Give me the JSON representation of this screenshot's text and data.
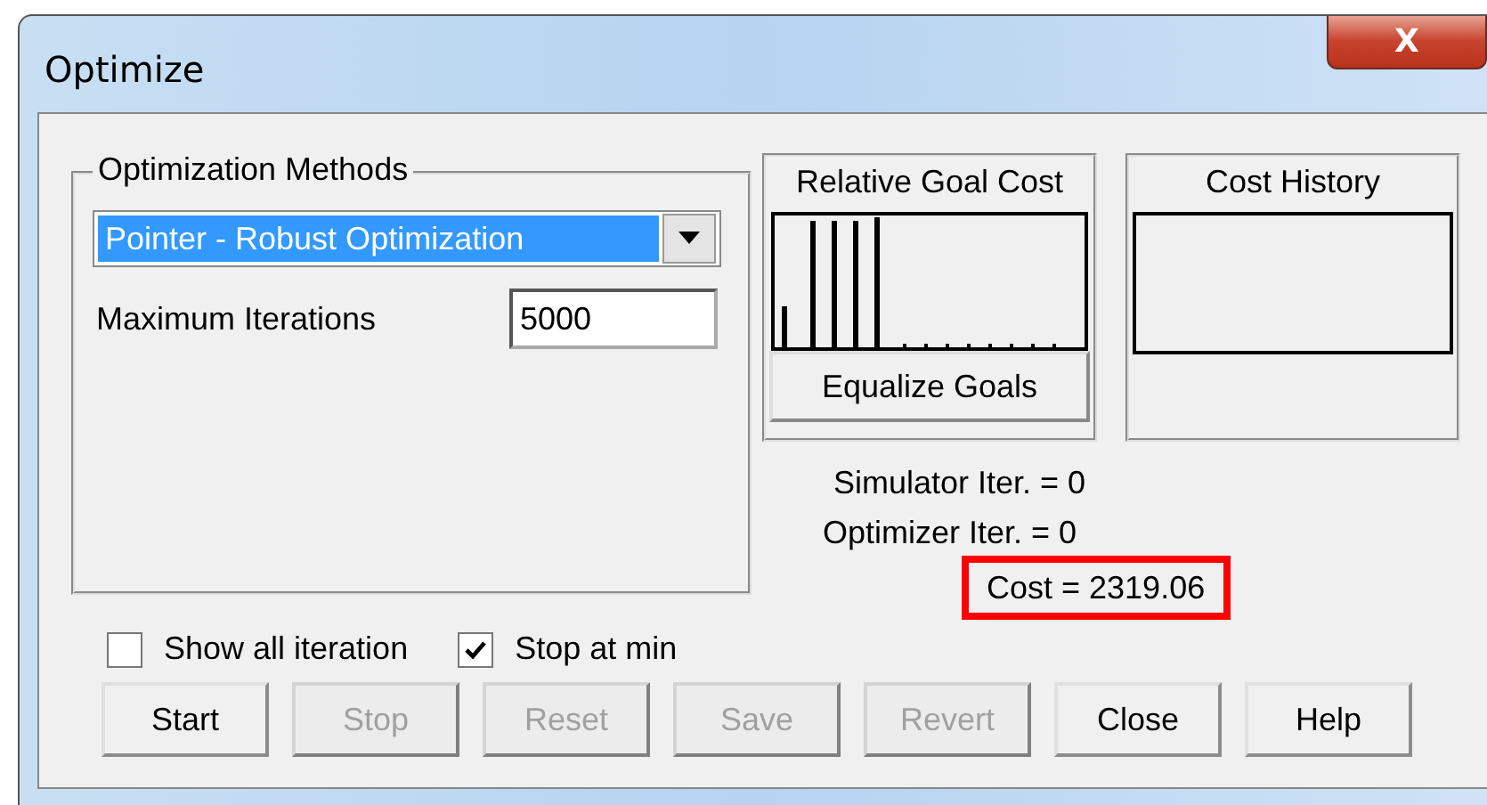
{
  "window": {
    "title": "Optimize",
    "close": "X"
  },
  "methods_group": {
    "title": "Optimization Methods",
    "method": "Pointer - Robust Optimization",
    "iterations_label": "Maximum Iterations",
    "iterations_value": "5000"
  },
  "goal_panel": {
    "title": "Relative Goal Cost",
    "button": "Equalize Goals"
  },
  "history_panel": {
    "title": "Cost History"
  },
  "readouts": [
    {
      "text": "Simulator Iter. =  0",
      "highlighted": false
    },
    {
      "text": "Optimizer  Iter. = 0",
      "highlighted": false
    },
    {
      "text": "Cost = 2319.06",
      "highlighted": true
    }
  ],
  "checkboxes": [
    {
      "label": "Show all iteration",
      "checked": false
    },
    {
      "label": "Stop at min",
      "checked": true
    }
  ],
  "buttons": [
    {
      "label": "Start",
      "disabled": false
    },
    {
      "label": "Stop",
      "disabled": true
    },
    {
      "label": "Reset",
      "disabled": true
    },
    {
      "label": "Save",
      "disabled": true
    },
    {
      "label": "Revert",
      "disabled": true
    },
    {
      "label": "Close",
      "disabled": false
    },
    {
      "label": "Help",
      "disabled": false
    }
  ]
}
